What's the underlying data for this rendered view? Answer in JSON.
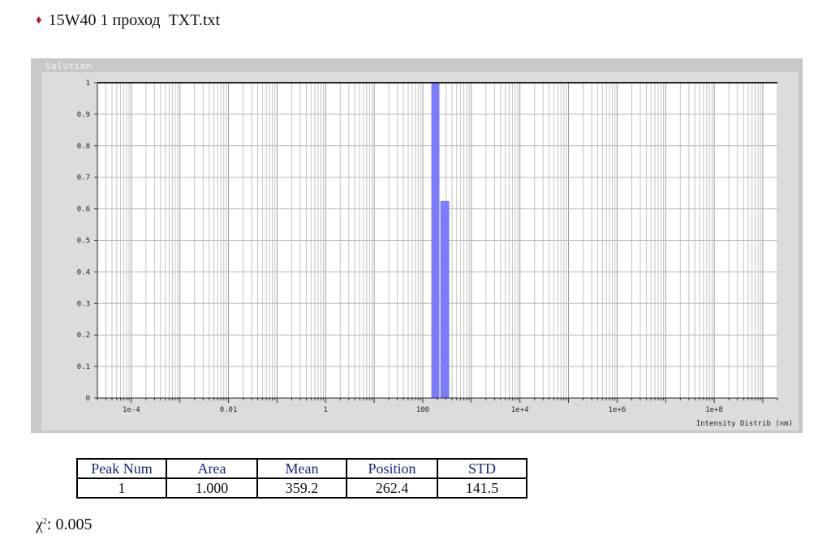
{
  "header": {
    "title": "15W40 1 проход  TXT.txt"
  },
  "panel": {
    "label": "Solution"
  },
  "chart_data": {
    "type": "bar",
    "xlabel": "Intensity Distrib (nm)",
    "ylabel": "",
    "xscale": "log",
    "xlim": [
      2e-05,
      2000000000
    ],
    "ylim": [
      0,
      1
    ],
    "x_ticks": [
      {
        "value": 0.0001,
        "label": "1e-4"
      },
      {
        "value": 0.01,
        "label": "0.01"
      },
      {
        "value": 1,
        "label": "1"
      },
      {
        "value": 100,
        "label": "100"
      },
      {
        "value": 10000,
        "label": "1e+4"
      },
      {
        "value": 1000000,
        "label": "1e+6"
      },
      {
        "value": 100000000,
        "label": "1e+8"
      }
    ],
    "y_ticks": [
      "0",
      "0.1",
      "0.2",
      "0.3",
      "0.4",
      "0.5",
      "0.6",
      "0.7",
      "0.8",
      "0.9",
      "1"
    ],
    "grid": true,
    "bar_color": "#7b7bff",
    "bars": [
      {
        "x_from": 150,
        "x_to": 220,
        "value": 1.0
      },
      {
        "x_from": 230,
        "x_to": 350,
        "value": 0.625
      }
    ]
  },
  "table": {
    "headers": [
      "Peak Num",
      "Area",
      "Mean",
      "Position",
      "STD"
    ],
    "rows": [
      [
        "1",
        "1.000",
        "359.2",
        "262.4",
        "141.5"
      ]
    ]
  },
  "chi": {
    "label": "χ",
    "sup": "2",
    "value": ": 0.005"
  }
}
